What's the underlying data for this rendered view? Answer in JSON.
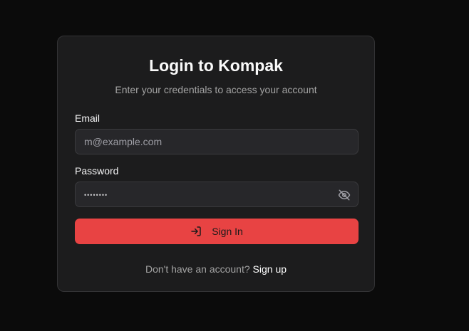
{
  "login": {
    "title": "Login to Kompak",
    "subtitle": "Enter your credentials to access your account",
    "email_label": "Email",
    "email_placeholder": "m@example.com",
    "password_label": "Password",
    "password_masked": "••••••••",
    "password_toggle_icon": "eye-off-icon",
    "submit_icon": "sign-in-icon",
    "submit_label": "Sign In",
    "footer_text": "Don't have an account?",
    "signup_link": "Sign up"
  },
  "colors": {
    "background": "#0b0b0b",
    "card": "#1c1c1d",
    "input": "#27272a",
    "primary": "#e84343"
  }
}
